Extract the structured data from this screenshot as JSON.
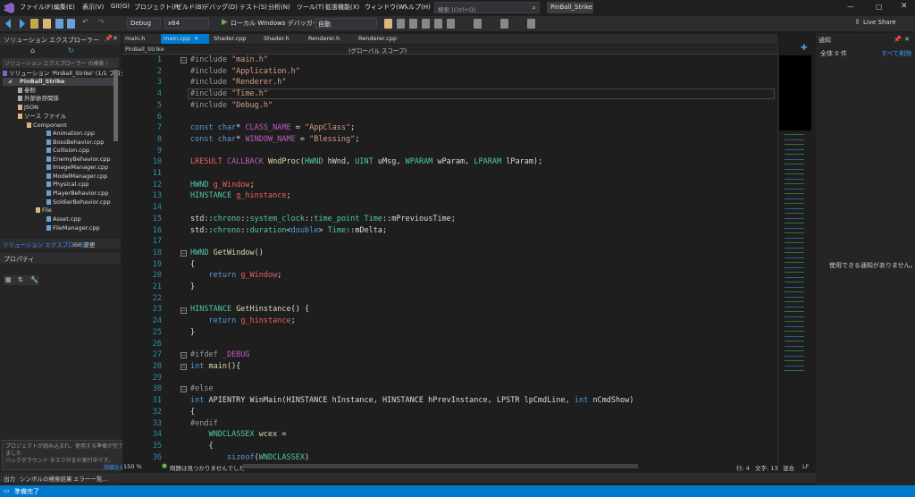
{
  "menu": {
    "items": [
      "ファイル(F)",
      "編集(E)",
      "表示(V)",
      "Git(G)",
      "プロジェクト(P)",
      "ビルド(B)",
      "デバッグ(D)",
      "テスト(S)",
      "分析(N)",
      "ツール(T)",
      "拡張機能(X)",
      "ウィンドウ(W)",
      "ヘルプ(H)"
    ],
    "search_placeholder": "検索 (Ctrl+Q)",
    "solution_name": "PinBall_Strike",
    "live_share": "Live Share"
  },
  "toolbar": {
    "config": "Debug",
    "platform": "x64",
    "run_label": "ローカル Windows デバッガー",
    "auto": "自動"
  },
  "solution_explorer": {
    "title": "ソリューション エクスプローラー",
    "search_placeholder": "ソリューション エクスプローラー の検索 (Ctrl+;)",
    "solution_line": "ソリューション 'PinBall_Strike' (1/1 プロジェクト)",
    "project": "PinBall_Strike",
    "items": [
      "参照",
      "外部依存関係",
      "JSON",
      "ソース ファイル",
      "Component",
      "Animation.cpp",
      "BossBehavior.cpp",
      "Collision.cpp",
      "EnemyBehavior.cpp",
      "ImageManager.cpp",
      "ModelManager.cpp",
      "Physical.cpp",
      "PlayerBehavior.cpp",
      "SoldierBehavior.cpp",
      "File",
      "Asset.cpp",
      "FileManager.cpp"
    ],
    "bottom_tabs": [
      "ソリューション エクスプローラー",
      "Git 変更"
    ]
  },
  "properties": {
    "title": "プロパティ"
  },
  "notification_popup": {
    "line1": "プロジェクトが読み込まれ、使用する準備が完了しました",
    "line2": "バックグラウンド タスクがまだ実行中です。",
    "line3": "詳細を表示"
  },
  "editor": {
    "tabs": [
      "main.h",
      "main.cpp",
      "Shader.cpp",
      "Shader.h",
      "Renderer.h",
      "Renderer.cpp"
    ],
    "active_tab": "main.cpp",
    "nav_project": "PinBall_Strike",
    "nav_scope": "(グローバル スコープ)",
    "zoom": "150 %",
    "issues": "問題は見つかりませんでした",
    "line_col": "行: 4",
    "char_col": "文字: 13",
    "mixed": "混合",
    "lf": "LF"
  },
  "notifications_panel": {
    "title": "通知",
    "count": "全体 0 件",
    "clear_all": "すべて削除",
    "empty_message": "使用できる通知がありません。"
  },
  "output_tabs": [
    "出力",
    "シンボルの検索結果",
    "エラー一覧..."
  ],
  "status": {
    "ready": "準備完了"
  }
}
